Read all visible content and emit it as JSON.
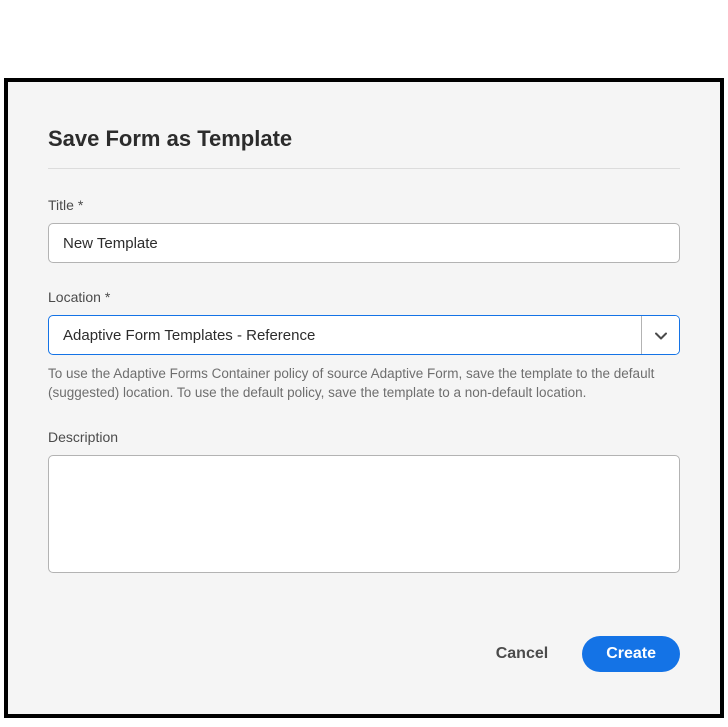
{
  "dialog": {
    "title": "Save Form as Template",
    "fields": {
      "title": {
        "label": "Title *",
        "value": "New Template"
      },
      "location": {
        "label": "Location *",
        "value": "Adaptive Form Templates - Reference",
        "help": "To use the Adaptive Forms Container policy of source Adaptive Form, save the template to the default (suggested) location. To use the default policy, save the template to a non-default location."
      },
      "description": {
        "label": "Description",
        "value": ""
      }
    },
    "buttons": {
      "cancel": "Cancel",
      "create": "Create"
    }
  }
}
